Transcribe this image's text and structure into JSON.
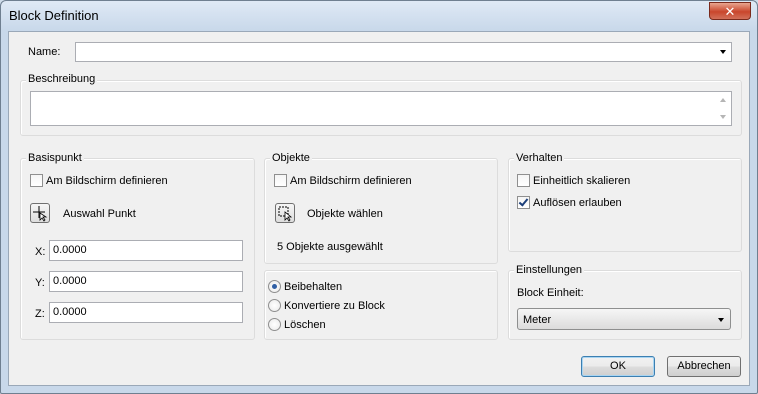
{
  "window": {
    "title": "Block Definition",
    "close_glyph": "✕"
  },
  "name": {
    "label": "Name:",
    "value": ""
  },
  "description": {
    "label": "Beschreibung",
    "value": ""
  },
  "basispunkt": {
    "title": "Basispunkt",
    "on_screen_label": "Am Bildschirm definieren",
    "on_screen_checked": false,
    "pick_label": "Auswahl Punkt",
    "x_label": "X:",
    "x_value": "0.0000",
    "y_label": "Y:",
    "y_value": "0.0000",
    "z_label": "Z:",
    "z_value": "0.0000"
  },
  "objekte": {
    "title": "Objekte",
    "on_screen_label": "Am Bildschirm definieren",
    "on_screen_checked": false,
    "select_label": "Objekte wählen",
    "status": "5 Objekte ausgewählt",
    "options": [
      {
        "label": "Beibehalten",
        "checked": true
      },
      {
        "label": "Konvertiere zu Block",
        "checked": false
      },
      {
        "label": "Löschen",
        "checked": false
      }
    ]
  },
  "verhalten": {
    "title": "Verhalten",
    "scale_label": "Einheitlich skalieren",
    "scale_checked": false,
    "explode_label": "Auflösen erlauben",
    "explode_checked": true
  },
  "einstellungen": {
    "title": "Einstellungen",
    "unit_label": "Block Einheit:",
    "unit_value": "Meter"
  },
  "buttons": {
    "ok": "OK",
    "cancel": "Abbrechen"
  }
}
